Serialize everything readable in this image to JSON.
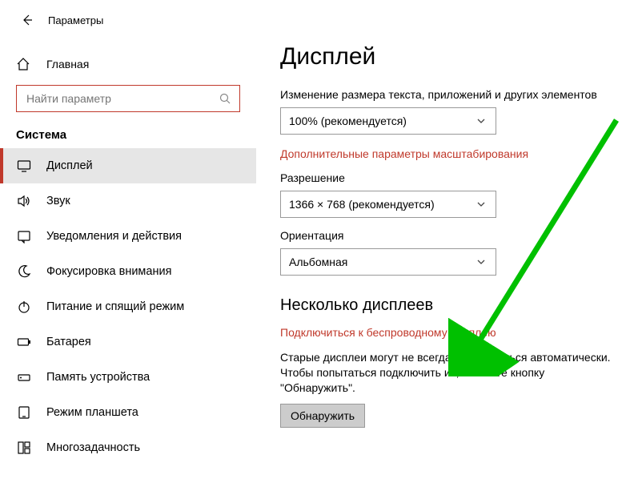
{
  "header": {
    "back": "←",
    "title": "Параметры"
  },
  "home": {
    "label": "Главная"
  },
  "search": {
    "placeholder": "Найти параметр"
  },
  "section": "Система",
  "nav": [
    {
      "label": "Дисплей",
      "active": true
    },
    {
      "label": "Звук"
    },
    {
      "label": "Уведомления и действия"
    },
    {
      "label": "Фокусировка внимания"
    },
    {
      "label": "Питание и спящий режим"
    },
    {
      "label": "Батарея"
    },
    {
      "label": "Память устройства"
    },
    {
      "label": "Режим планшета"
    },
    {
      "label": "Многозадачность"
    }
  ],
  "main": {
    "title": "Дисплей",
    "scale_label": "Изменение размера текста, приложений и других элементов",
    "scale_value": "100% (рекомендуется)",
    "scale_link": "Дополнительные параметры масштабирования",
    "resolution_label": "Разрешение",
    "resolution_value": "1366 × 768 (рекомендуется)",
    "orientation_label": "Ориентация",
    "orientation_value": "Альбомная",
    "multi_title": "Несколько дисплеев",
    "wireless_link": "Подключиться к беспроводному дисплею",
    "old_displays_info": "Старые дисплеи могут не всегда подключаться автоматически. Чтобы попытаться подключить их, нажмите кнопку \"Обнаружить\".",
    "detect_btn": "Обнаружить"
  },
  "colors": {
    "accent": "#c0392b",
    "arrow": "#00c000"
  }
}
